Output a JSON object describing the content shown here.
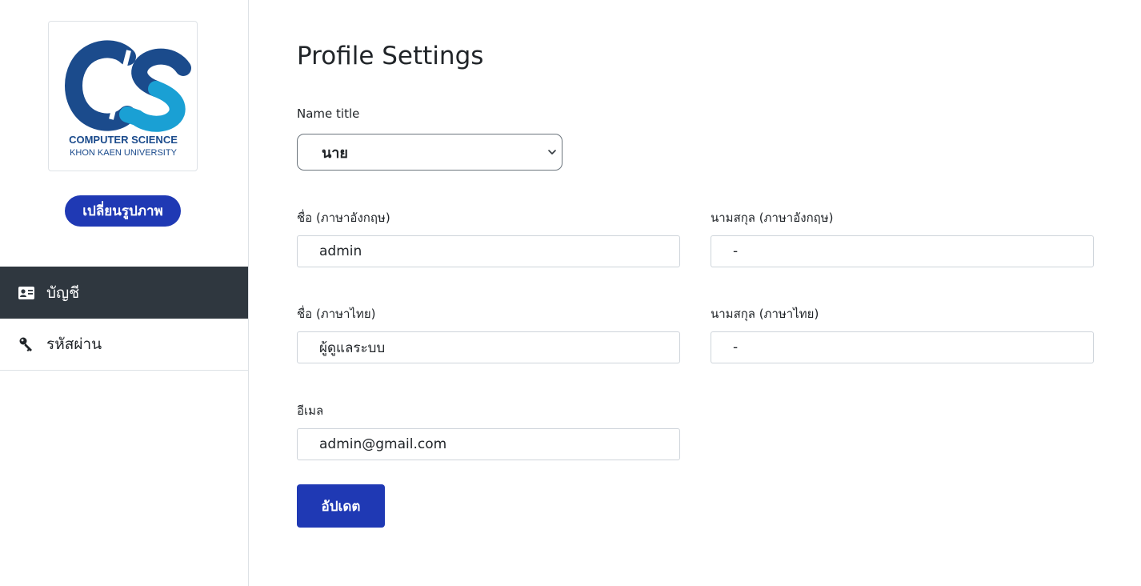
{
  "sidebar": {
    "logo": {
      "mark": "CS",
      "line1": "COMPUTER SCIENCE",
      "line2": "KHON KAEN UNIVERSITY",
      "colors": {
        "dark": "#1b4b8c",
        "light": "#1aa0d4"
      }
    },
    "change_photo_label": "เปลี่ยนรูปภาพ",
    "items": [
      {
        "label": "บัญชี",
        "icon": "id-card-icon",
        "active": true
      },
      {
        "label": "รหัสผ่าน",
        "icon": "key-icon",
        "active": false
      }
    ]
  },
  "main": {
    "title": "Profile Settings",
    "name_title": {
      "label": "Name title",
      "value": "นาย"
    },
    "first_name_en": {
      "label": "ชื่อ (ภาษาอังกฤษ)",
      "value": "admin"
    },
    "last_name_en": {
      "label": "นามสกุล (ภาษาอังกฤษ)",
      "value": "-"
    },
    "first_name_th": {
      "label": "ชื่อ (ภาษาไทย)",
      "value": "ผู้ดูแลระบบ"
    },
    "last_name_th": {
      "label": "นามสกุล (ภาษาไทย)",
      "value": "-"
    },
    "email": {
      "label": "อีเมล",
      "value": "admin@gmail.com"
    },
    "update_label": "อัปเดต"
  },
  "colors": {
    "primary": "#1f39b4",
    "nav_active_bg": "#2f373f"
  }
}
